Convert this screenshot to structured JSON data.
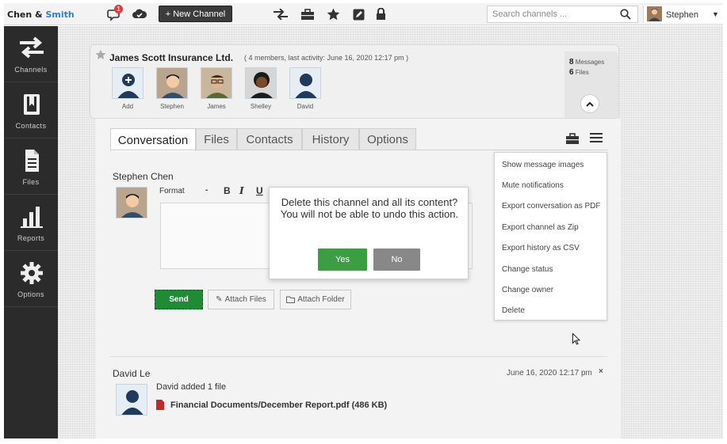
{
  "topbar": {
    "brand_part1": "Chen & ",
    "brand_part2": "Smith",
    "notification_count": "1",
    "new_channel_label": "+ New Channel",
    "search_placeholder": "Search channels ...",
    "user_name": "Stephen"
  },
  "sidebar": {
    "items": [
      {
        "label": "Channels",
        "icon": "arrows-icon"
      },
      {
        "label": "Contacts",
        "icon": "contacts-icon"
      },
      {
        "label": "Files",
        "icon": "file-icon"
      },
      {
        "label": "Reports",
        "icon": "bar-chart-icon"
      },
      {
        "label": "Options",
        "icon": "gear-icon"
      }
    ]
  },
  "channel": {
    "title": "James Scott Insurance Ltd.",
    "meta": "( 4 members, last activity: June 16, 2020 12:17 pm )",
    "members": [
      "Add",
      "Stephen",
      "James",
      "Shelley",
      "David"
    ],
    "messages_count": "8",
    "messages_label": "Messages",
    "files_count": "6",
    "files_label": "Files"
  },
  "tabs": [
    "Conversation",
    "Files",
    "Contacts",
    "History",
    "Options"
  ],
  "menu": {
    "items": [
      "Show message images",
      "Mute notifications",
      "Export conversation as PDF",
      "Export channel as Zip",
      "Export history as CSV",
      "Change status",
      "Change owner",
      "Delete"
    ]
  },
  "composer": {
    "author": "Stephen Chen",
    "format_label": "Format",
    "send_label": "Send",
    "attach_files_label": "Attach Files",
    "attach_folder_label": "Attach Folder"
  },
  "message": {
    "author": "David Le",
    "time": "June 16, 2020 12:17 pm",
    "close": "×",
    "text": "David added 1 file",
    "file": "Financial Documents/December Report.pdf (486 KB)"
  },
  "dialog": {
    "text": "Delete this channel and all its content? You will not be able to undo this action.",
    "yes_label": "Yes",
    "no_label": "No"
  },
  "colors": {
    "accent_blue": "#2f7fd1",
    "sidebar_bg": "#2b2b2b",
    "send_green": "#1f8b35",
    "yes_green": "#3c9e43",
    "no_gray": "#888888",
    "pdf_red": "#c62828"
  }
}
